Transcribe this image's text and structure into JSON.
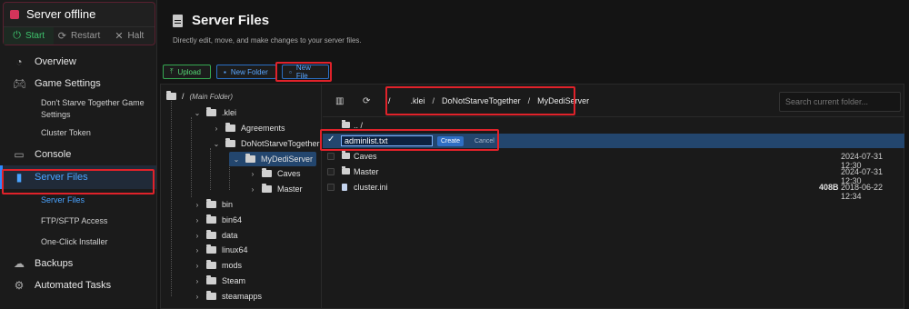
{
  "server": {
    "status_text": "Server offline",
    "status_color": "#d2345a",
    "buttons": [
      {
        "label": "Start",
        "icon": "power-icon"
      },
      {
        "label": "Restart",
        "icon": "refresh-icon"
      },
      {
        "label": "Halt",
        "icon": "close-icon"
      }
    ]
  },
  "nav": {
    "overview": "Overview",
    "game_settings": "Game Settings",
    "dst_game_settings": "Don't Starve Together Game Settings",
    "cluster_token": "Cluster Token",
    "console": "Console",
    "server_files": "Server Files",
    "sub_server_files": "Server Files",
    "ftp_access": "FTP/SFTP Access",
    "one_click": "One-Click Installer",
    "backups": "Backups",
    "automated_tasks": "Automated Tasks"
  },
  "header": {
    "title": "Server Files",
    "description": "Directly edit, move, and make changes to your server files."
  },
  "toolbar": {
    "upload": "Upload",
    "new_folder": "New Folder",
    "new_file": "New File"
  },
  "tree": {
    "root_slash": "/",
    "root_label": "(Main Folder)",
    "klei": ".klei",
    "agreements": "Agreements",
    "dst": "DoNotStarveTogether",
    "mydedi": "MyDediServer",
    "caves": "Caves",
    "master": "Master",
    "bin": "bin",
    "bin64": "bin64",
    "data": "data",
    "linux64": "linux64",
    "mods": "mods",
    "steam": "Steam",
    "steamapps": "steamapps"
  },
  "breadcrumb": {
    "root": "/",
    "sep": "/",
    "parts": [
      ".klei",
      "DoNotStarveTogether",
      "MyDediServer"
    ]
  },
  "search": {
    "placeholder": "Search current folder..."
  },
  "files": {
    "parent": ".. /",
    "new_file_value": "adminlist.txt",
    "create": "Create",
    "cancel": "Cancel",
    "rows": [
      {
        "name": "Caves",
        "size": "",
        "date": "2024-07-31 12:30"
      },
      {
        "name": "Master",
        "size": "",
        "date": "2024-07-31 12:30"
      },
      {
        "name": "cluster.ini",
        "size": "408B",
        "date": "2018-06-22 12:34"
      }
    ]
  },
  "colors": {
    "accent": "#2f88ff",
    "highlight": "#e0222a",
    "success": "#3ec46d"
  }
}
